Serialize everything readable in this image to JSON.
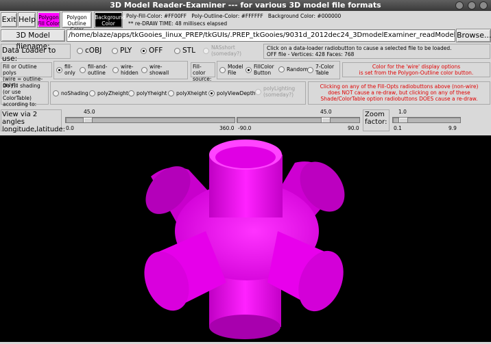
{
  "window": {
    "title": "3D Model Reader-Examiner --- for various 3D model file formats"
  },
  "toolbar": {
    "exit": "Exit",
    "help": "Help",
    "poly_fill_color": [
      "Polygon",
      "Fill Color"
    ],
    "poly_outline_color": [
      "Polygon",
      "Outline Color"
    ],
    "background_color": [
      "Background",
      "Color"
    ],
    "colors_text": "Poly-Fill-Color: #FF00FF   Poly-Outline-Color: #FFFFFF   Background Color: #000000",
    "redraw_text": "** re-DRAW TIME: 48 millisecs elapsed",
    "colors": {
      "fill": "#FF00FF",
      "outline": "#FFFFFF",
      "background": "#000000"
    }
  },
  "file": {
    "label": "3D Model filename:",
    "value": "/home/blaze/apps/tkGooies_linux_PREP/tkGUIs/.PREP_tkGooies/9031d_2012dec24_3DmodelExaminer_readModelFiles",
    "browse": "Browse..."
  },
  "loader": {
    "label": "Data Loader to use:",
    "options": [
      {
        "label": "cOBJ",
        "on": false
      },
      {
        "label": "PLY",
        "on": false
      },
      {
        "label": "OFF",
        "on": true
      },
      {
        "label": "STL",
        "on": false
      }
    ],
    "nas": [
      "NASshort",
      "(someday?)"
    ],
    "info1": "Click on a data-loader radiobutton to cause a selected file to be loaded.",
    "info2": "OFF file - Vertices: 428   Faces: 768"
  },
  "fill": {
    "label": [
      "Fill or Outline polys",
      "(wire = outline-only):"
    ],
    "options": [
      {
        "label": [
          "fill-",
          "only"
        ],
        "on": true
      },
      {
        "label": [
          "fill-and-",
          "outline"
        ],
        "on": false
      },
      {
        "label": [
          "wire-",
          "hidden"
        ],
        "on": false
      },
      {
        "label": [
          "wire-",
          "showall"
        ],
        "on": false
      }
    ]
  },
  "fillcolor": {
    "label": [
      "Fill-color",
      "source:"
    ],
    "options": [
      {
        "label": [
          "Model",
          "File"
        ],
        "on": false
      },
      {
        "label": [
          "FillColor",
          "Button"
        ],
        "on": true
      },
      {
        "label": [
          "Random"
        ],
        "on": false
      },
      {
        "label": [
          "7-Color",
          "Table"
        ],
        "on": false
      }
    ],
    "note": [
      "Color for the 'wire' display options",
      "is set from the Polygon-Outline color button."
    ]
  },
  "shading": {
    "label": [
      "Do Fill shading",
      "(or use ColorTable)",
      "according to:"
    ],
    "options": [
      {
        "label": "noShading",
        "on": false
      },
      {
        "label": "polyZheight",
        "on": false
      },
      {
        "label": "polyYheight",
        "on": false
      },
      {
        "label": "polyXheight",
        "on": false
      },
      {
        "label": "polyViewDepth",
        "on": true
      }
    ],
    "lighting": [
      "polyLighting",
      "(someday?)"
    ],
    "note": [
      "Clicking on any of the Fill-Opts radiobuttons above (non-wire)",
      "does NOT cause a re-draw, but clicking on any of these",
      "Shade/ColorTable option radiobuttons DOES cause a re-draw."
    ]
  },
  "view": {
    "label": [
      "View via 2 angles",
      "longitude,latitude:"
    ],
    "longitude": {
      "value": "45.0",
      "min": "0.0",
      "max": "360.0",
      "fraction": 0.125
    },
    "latitude": {
      "value": "45.0",
      "min": "-90.0",
      "max": "90.0",
      "fraction": 0.75
    },
    "zoom_label": [
      "Zoom",
      "factor:"
    ],
    "zoom": {
      "value": "1.0",
      "min": "0.1",
      "max": "9.9",
      "fraction": 0.092
    }
  }
}
